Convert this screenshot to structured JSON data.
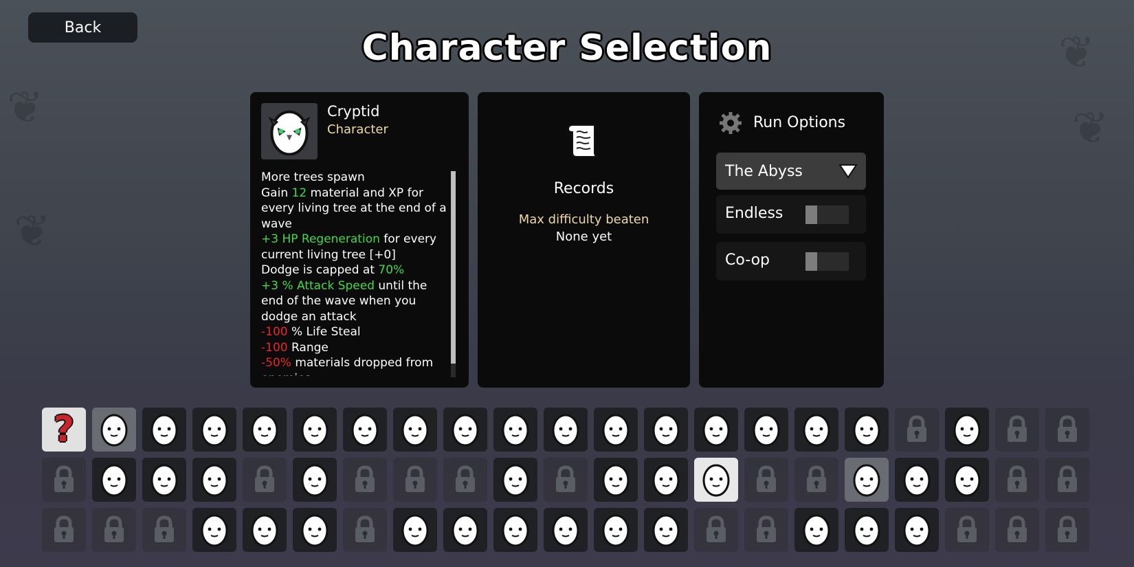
{
  "nav": {
    "back_label": "Back"
  },
  "page_title": "Character Selection",
  "character": {
    "name": "Cryptid",
    "type": "Character",
    "portrait_icon": "cryptid-egg-icon",
    "description": [
      [
        {
          "t": "More trees spawn",
          "c": "w"
        }
      ],
      [
        {
          "t": "Gain ",
          "c": "w"
        },
        {
          "t": "12",
          "c": "g"
        },
        {
          "t": " material and XP for every living tree at the end of a wave",
          "c": "w"
        }
      ],
      [
        {
          "t": "+3 HP Regeneration",
          "c": "g"
        },
        {
          "t": " for every current living tree [+0]",
          "c": "w"
        }
      ],
      [
        {
          "t": "Dodge is capped at ",
          "c": "w"
        },
        {
          "t": "70%",
          "c": "g"
        }
      ],
      [
        {
          "t": "+3 % Attack Speed",
          "c": "g"
        },
        {
          "t": " until the end of the wave when you dodge an attack",
          "c": "w"
        }
      ],
      [
        {
          "t": "-100",
          "c": "r"
        },
        {
          "t": " % Life Steal",
          "c": "w"
        }
      ],
      [
        {
          "t": "-100",
          "c": "r"
        },
        {
          "t": " Range",
          "c": "w"
        }
      ],
      [
        {
          "t": "-50%",
          "c": "r"
        },
        {
          "t": " materials dropped from enemies",
          "c": "w"
        }
      ]
    ]
  },
  "records": {
    "icon": "scroll-icon",
    "title": "Records",
    "max_difficulty_label": "Max difficulty beaten",
    "max_difficulty_value": "None yet"
  },
  "run_options": {
    "icon": "gear-icon",
    "title": "Run Options",
    "mode_selected": "The Abyss",
    "endless_label": "Endless",
    "endless_on": false,
    "coop_label": "Co-op",
    "coop_on": false
  },
  "colors": {
    "positive": "#41d94a",
    "negative": "#e8262d",
    "accent_text": "#efd9a6",
    "panel_bg": "#0b0b0b"
  },
  "character_grid": [
    [
      "random",
      "hover",
      "u",
      "u",
      "u",
      "u",
      "u",
      "u",
      "u",
      "u",
      "u",
      "u",
      "u",
      "u",
      "u",
      "u",
      "u",
      "locked",
      "u",
      "locked",
      "locked"
    ],
    [
      "locked",
      "u",
      "u",
      "u",
      "locked",
      "u",
      "locked",
      "locked",
      "locked",
      "u",
      "locked",
      "u",
      "u",
      "selected",
      "locked",
      "locked",
      "hover",
      "u",
      "u",
      "locked",
      "locked"
    ],
    [
      "locked",
      "locked",
      "locked",
      "u",
      "u",
      "u",
      "locked",
      "u",
      "u",
      "u",
      "u",
      "u",
      "u",
      "locked",
      "locked",
      "u",
      "u",
      "u",
      "locked",
      "locked",
      "locked"
    ]
  ]
}
